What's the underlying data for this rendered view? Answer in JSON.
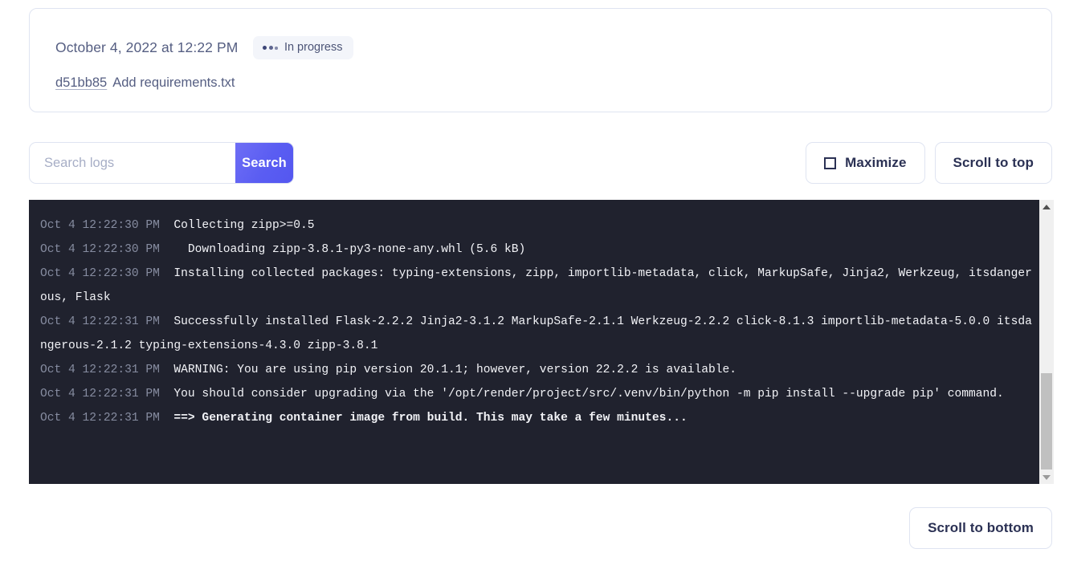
{
  "deploy": {
    "timestamp": "October 4, 2022 at 12:22 PM",
    "status_label": "In progress",
    "status_icon": "three-dots-loading-icon",
    "commit_hash": "d51bb85",
    "commit_message": "Add requirements.txt"
  },
  "toolbar": {
    "search_placeholder": "Search logs",
    "search_value": "",
    "search_button_label": "Search",
    "maximize_label": "Maximize",
    "maximize_icon": "maximize-corners-icon",
    "scroll_to_top_label": "Scroll to top"
  },
  "footer": {
    "scroll_to_bottom_label": "Scroll to bottom"
  },
  "colors": {
    "accent": "#5a5df2",
    "log_background": "#20222e",
    "log_text": "#f2f3f7",
    "log_timestamp": "#868ca0",
    "border": "#dfe4f1",
    "badge_background": "#f3f5fa"
  },
  "logs": {
    "lines": [
      {
        "timestamp": "Oct 4 12:22:30 PM",
        "message": "Collecting zipp>=0.5",
        "bold": false
      },
      {
        "timestamp": "Oct 4 12:22:30 PM",
        "message": "  Downloading zipp-3.8.1-py3-none-any.whl (5.6 kB)",
        "bold": false
      },
      {
        "timestamp": "Oct 4 12:22:30 PM",
        "message": "Installing collected packages: typing-extensions, zipp, importlib-metadata, click, MarkupSafe, Jinja2, Werkzeug, itsdangerous, Flask",
        "bold": false
      },
      {
        "timestamp": "Oct 4 12:22:31 PM",
        "message": "Successfully installed Flask-2.2.2 Jinja2-3.1.2 MarkupSafe-2.1.1 Werkzeug-2.2.2 click-8.1.3 importlib-metadata-5.0.0 itsdangerous-2.1.2 typing-extensions-4.3.0 zipp-3.8.1",
        "bold": false
      },
      {
        "timestamp": "Oct 4 12:22:31 PM",
        "message": "WARNING: You are using pip version 20.1.1; however, version 22.2.2 is available.",
        "bold": false
      },
      {
        "timestamp": "Oct 4 12:22:31 PM",
        "message": "You should consider upgrading via the '/opt/render/project/src/.venv/bin/python -m pip install --upgrade pip' command.",
        "bold": false
      },
      {
        "timestamp": "Oct 4 12:22:31 PM",
        "message": "==> Generating container image from build. This may take a few minutes...",
        "bold": true
      }
    ]
  }
}
